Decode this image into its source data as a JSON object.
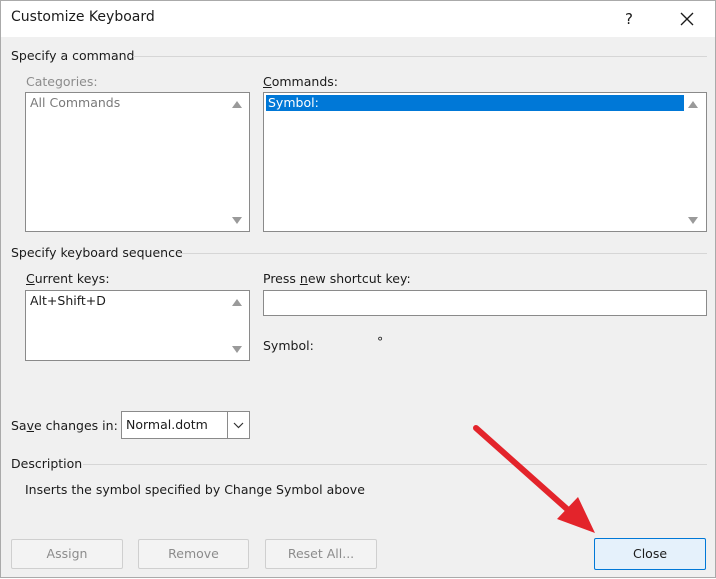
{
  "window": {
    "title": "Customize Keyboard",
    "help_label": "?"
  },
  "command_section": {
    "heading": "Specify a command",
    "categories_label": "Categories:",
    "categories": [
      "All Commands"
    ],
    "commands_label_first": "C",
    "commands_label_rest": "ommands:",
    "commands": [
      "Symbol:"
    ]
  },
  "sequence_section": {
    "heading": "Specify keyboard sequence",
    "current_keys_label_first": "C",
    "current_keys_label_rest": "urrent keys:",
    "current_keys": [
      "Alt+Shift+D"
    ],
    "press_label_a": "Press ",
    "press_label_u": "n",
    "press_label_b": "ew shortcut key:",
    "press_value": "",
    "symbol_label": "Symbol:",
    "symbol_value": "°"
  },
  "save": {
    "label_a": "Sa",
    "label_u": "v",
    "label_b": "e changes in:",
    "selected": "Normal.dotm"
  },
  "description": {
    "heading": "Description",
    "text": "Inserts the symbol specified by Change Symbol above"
  },
  "buttons": {
    "assign": "Assign",
    "remove": "Remove",
    "reset_all": "Reset All...",
    "close": "Close"
  },
  "colors": {
    "selection": "#0078d7",
    "annotation_arrow": "#e3242b"
  },
  "icons": [
    "close-icon",
    "scroll-up-arrow-icon",
    "scroll-down-arrow-icon",
    "chevron-down-icon",
    "red-arrow-annotation"
  ]
}
